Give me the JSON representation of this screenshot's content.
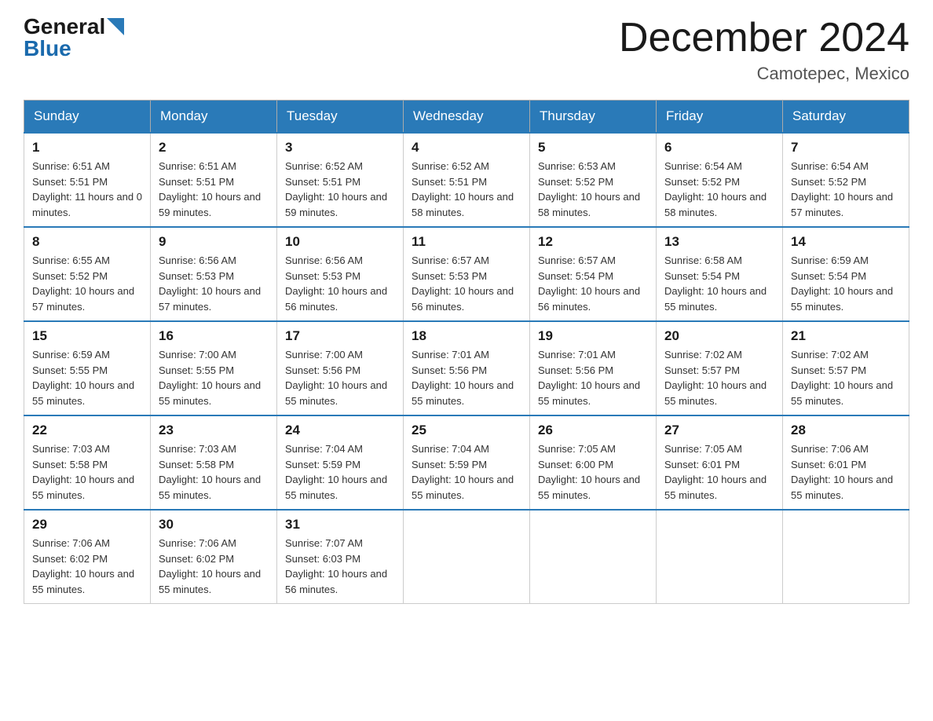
{
  "header": {
    "logo_general": "General",
    "logo_blue": "Blue",
    "title": "December 2024",
    "location": "Camotepec, Mexico"
  },
  "days_of_week": [
    "Sunday",
    "Monday",
    "Tuesday",
    "Wednesday",
    "Thursday",
    "Friday",
    "Saturday"
  ],
  "weeks": [
    [
      {
        "day": "1",
        "sunrise": "6:51 AM",
        "sunset": "5:51 PM",
        "daylight": "11 hours and 0 minutes."
      },
      {
        "day": "2",
        "sunrise": "6:51 AM",
        "sunset": "5:51 PM",
        "daylight": "10 hours and 59 minutes."
      },
      {
        "day": "3",
        "sunrise": "6:52 AM",
        "sunset": "5:51 PM",
        "daylight": "10 hours and 59 minutes."
      },
      {
        "day": "4",
        "sunrise": "6:52 AM",
        "sunset": "5:51 PM",
        "daylight": "10 hours and 58 minutes."
      },
      {
        "day": "5",
        "sunrise": "6:53 AM",
        "sunset": "5:52 PM",
        "daylight": "10 hours and 58 minutes."
      },
      {
        "day": "6",
        "sunrise": "6:54 AM",
        "sunset": "5:52 PM",
        "daylight": "10 hours and 58 minutes."
      },
      {
        "day": "7",
        "sunrise": "6:54 AM",
        "sunset": "5:52 PM",
        "daylight": "10 hours and 57 minutes."
      }
    ],
    [
      {
        "day": "8",
        "sunrise": "6:55 AM",
        "sunset": "5:52 PM",
        "daylight": "10 hours and 57 minutes."
      },
      {
        "day": "9",
        "sunrise": "6:56 AM",
        "sunset": "5:53 PM",
        "daylight": "10 hours and 57 minutes."
      },
      {
        "day": "10",
        "sunrise": "6:56 AM",
        "sunset": "5:53 PM",
        "daylight": "10 hours and 56 minutes."
      },
      {
        "day": "11",
        "sunrise": "6:57 AM",
        "sunset": "5:53 PM",
        "daylight": "10 hours and 56 minutes."
      },
      {
        "day": "12",
        "sunrise": "6:57 AM",
        "sunset": "5:54 PM",
        "daylight": "10 hours and 56 minutes."
      },
      {
        "day": "13",
        "sunrise": "6:58 AM",
        "sunset": "5:54 PM",
        "daylight": "10 hours and 55 minutes."
      },
      {
        "day": "14",
        "sunrise": "6:59 AM",
        "sunset": "5:54 PM",
        "daylight": "10 hours and 55 minutes."
      }
    ],
    [
      {
        "day": "15",
        "sunrise": "6:59 AM",
        "sunset": "5:55 PM",
        "daylight": "10 hours and 55 minutes."
      },
      {
        "day": "16",
        "sunrise": "7:00 AM",
        "sunset": "5:55 PM",
        "daylight": "10 hours and 55 minutes."
      },
      {
        "day": "17",
        "sunrise": "7:00 AM",
        "sunset": "5:56 PM",
        "daylight": "10 hours and 55 minutes."
      },
      {
        "day": "18",
        "sunrise": "7:01 AM",
        "sunset": "5:56 PM",
        "daylight": "10 hours and 55 minutes."
      },
      {
        "day": "19",
        "sunrise": "7:01 AM",
        "sunset": "5:56 PM",
        "daylight": "10 hours and 55 minutes."
      },
      {
        "day": "20",
        "sunrise": "7:02 AM",
        "sunset": "5:57 PM",
        "daylight": "10 hours and 55 minutes."
      },
      {
        "day": "21",
        "sunrise": "7:02 AM",
        "sunset": "5:57 PM",
        "daylight": "10 hours and 55 minutes."
      }
    ],
    [
      {
        "day": "22",
        "sunrise": "7:03 AM",
        "sunset": "5:58 PM",
        "daylight": "10 hours and 55 minutes."
      },
      {
        "day": "23",
        "sunrise": "7:03 AM",
        "sunset": "5:58 PM",
        "daylight": "10 hours and 55 minutes."
      },
      {
        "day": "24",
        "sunrise": "7:04 AM",
        "sunset": "5:59 PM",
        "daylight": "10 hours and 55 minutes."
      },
      {
        "day": "25",
        "sunrise": "7:04 AM",
        "sunset": "5:59 PM",
        "daylight": "10 hours and 55 minutes."
      },
      {
        "day": "26",
        "sunrise": "7:05 AM",
        "sunset": "6:00 PM",
        "daylight": "10 hours and 55 minutes."
      },
      {
        "day": "27",
        "sunrise": "7:05 AM",
        "sunset": "6:01 PM",
        "daylight": "10 hours and 55 minutes."
      },
      {
        "day": "28",
        "sunrise": "7:06 AM",
        "sunset": "6:01 PM",
        "daylight": "10 hours and 55 minutes."
      }
    ],
    [
      {
        "day": "29",
        "sunrise": "7:06 AM",
        "sunset": "6:02 PM",
        "daylight": "10 hours and 55 minutes."
      },
      {
        "day": "30",
        "sunrise": "7:06 AM",
        "sunset": "6:02 PM",
        "daylight": "10 hours and 55 minutes."
      },
      {
        "day": "31",
        "sunrise": "7:07 AM",
        "sunset": "6:03 PM",
        "daylight": "10 hours and 56 minutes."
      },
      null,
      null,
      null,
      null
    ]
  ]
}
